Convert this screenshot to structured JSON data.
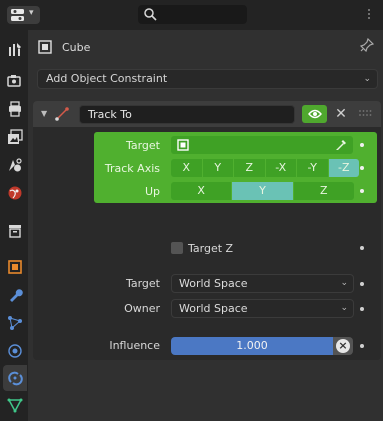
{
  "header": {
    "search_placeholder": ""
  },
  "object": {
    "name": "Cube"
  },
  "add_constraint": {
    "label": "Add Object Constraint"
  },
  "constraint": {
    "name": "Track To",
    "target_label": "Target",
    "track_axis_label": "Track Axis",
    "track_axis_options": [
      "X",
      "Y",
      "Z",
      "-X",
      "-Y",
      "-Z"
    ],
    "track_axis_selected": "-Z",
    "up_label": "Up",
    "up_options": [
      "X",
      "Y",
      "Z"
    ],
    "up_selected": "Y",
    "target_z_label": "Target Z",
    "target_z_checked": false,
    "target_space_label": "Target",
    "target_space_value": "World Space",
    "owner_space_label": "Owner",
    "owner_space_value": "World Space",
    "influence_label": "Influence",
    "influence_value": "1.000"
  },
  "colors": {
    "enabled_green": "#50b02f",
    "selected_axis": "#6ac2b5",
    "slider_blue": "#4b78c4"
  },
  "tabs": [
    "tool-tab",
    "render-tab",
    "output-tab",
    "view-layer-tab",
    "scene-tab",
    "world-tab",
    "collection-tab",
    "object-tab",
    "modifier-tab",
    "particles-tab",
    "physics-tab",
    "constraints-tab",
    "data-tab"
  ]
}
